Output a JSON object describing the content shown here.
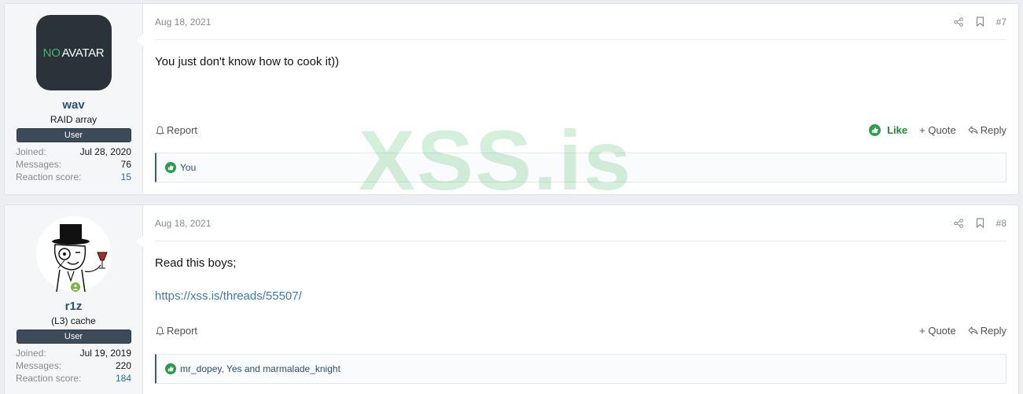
{
  "posts": [
    {
      "user": {
        "avatar_text_no": "NO",
        "avatar_text_rest": "AVATAR",
        "name": "wav",
        "title": "RAID array",
        "banner": "User",
        "stats": [
          {
            "label": "Joined:",
            "value": "Jul 28, 2020"
          },
          {
            "label": "Messages:",
            "value": "76"
          },
          {
            "label": "Reaction score:",
            "value": "15"
          }
        ]
      },
      "date": "Aug 18, 2021",
      "number": "#7",
      "text": "You just don't know how to cook it))",
      "report_label": "Report",
      "like_label": "Like",
      "quote_label": "+ Quote",
      "reply_label": "Reply",
      "reactions": "You"
    },
    {
      "user": {
        "name": "r1z",
        "title": "(L3) cache",
        "banner": "User",
        "stats": [
          {
            "label": "Joined:",
            "value": "Jul 19, 2019"
          },
          {
            "label": "Messages:",
            "value": "220"
          },
          {
            "label": "Reaction score:",
            "value": "184"
          }
        ]
      },
      "date": "Aug 18, 2021",
      "number": "#8",
      "text": "Read this boys;",
      "link": "https://xss.is/threads/55507/",
      "report_label": "Report",
      "quote_label": "+ Quote",
      "reply_label": "Reply",
      "reactions": "mr_dopey, Yes and marmalade_knight"
    }
  ],
  "watermark": "XSS.is",
  "colors": {
    "like_green": "#1f8a3a",
    "link_blue": "#2d6aa3",
    "username": "#2d4f72",
    "banner_bg": "#3c4a5a"
  },
  "icons": [
    "share-icon",
    "bookmark-icon",
    "bell-icon",
    "thumbs-up-icon",
    "reply-icon",
    "online-user-icon"
  ]
}
